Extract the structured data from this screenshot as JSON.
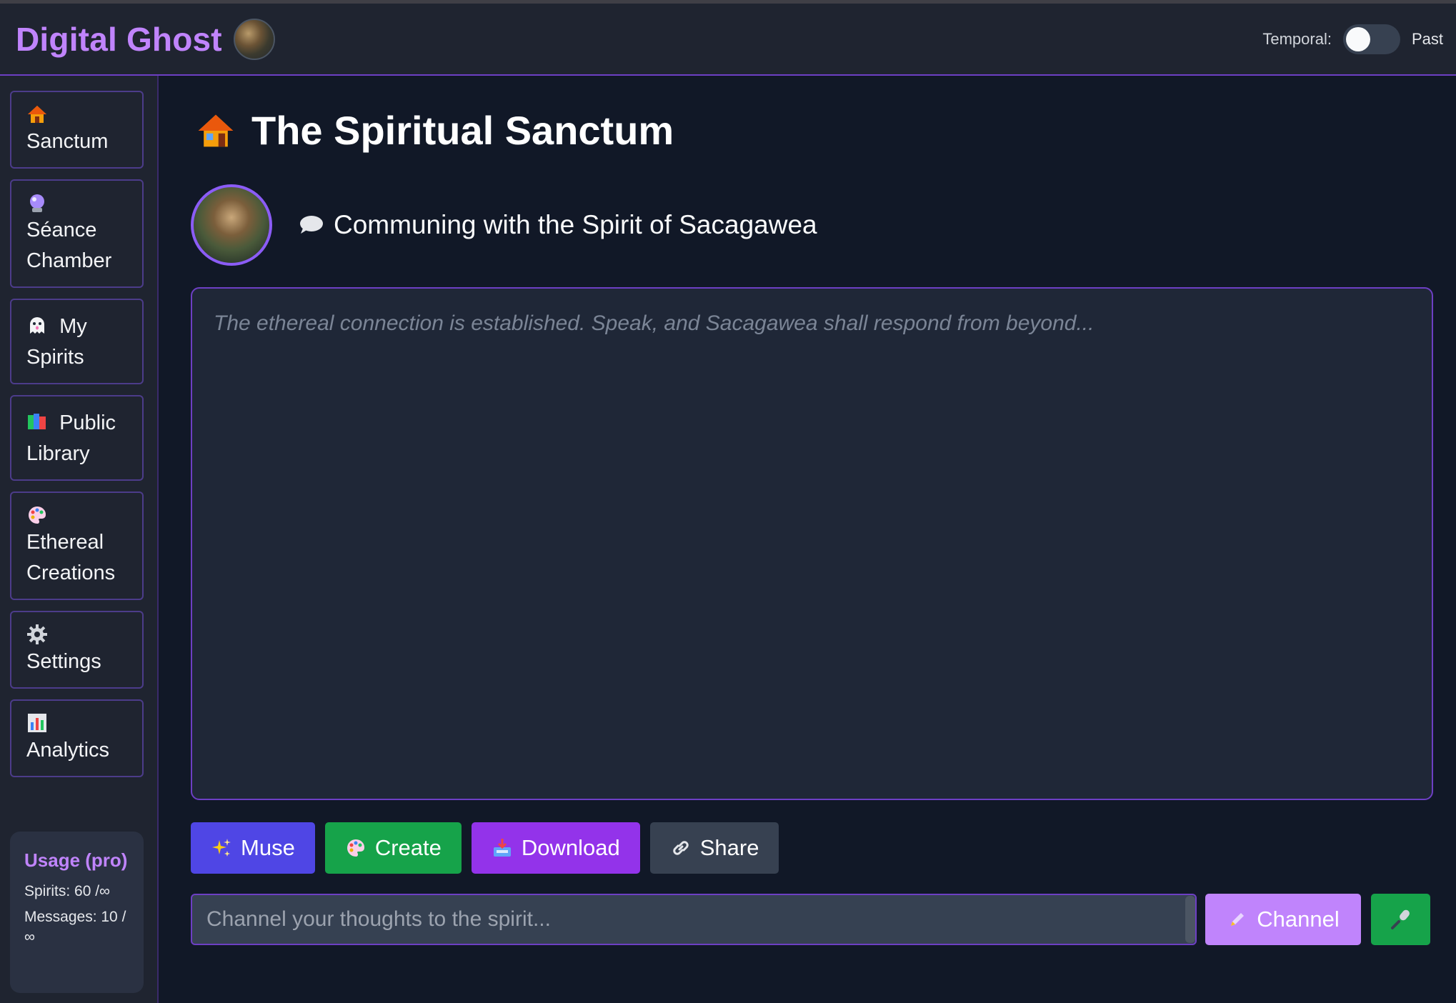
{
  "header": {
    "brand": "Digital Ghost",
    "temporal_label": "Temporal:",
    "temporal_value": "Past"
  },
  "sidebar": {
    "items": [
      {
        "label": "Sanctum",
        "icon": "house-icon"
      },
      {
        "label": "Séance Chamber",
        "icon": "crystal-ball-icon"
      },
      {
        "label": "My Spirits",
        "icon": "ghost-icon"
      },
      {
        "label": "Public Library",
        "icon": "books-icon"
      },
      {
        "label": "Ethereal Creations",
        "icon": "palette-icon"
      },
      {
        "label": "Settings",
        "icon": "gear-icon"
      },
      {
        "label": "Analytics",
        "icon": "bar-chart-icon"
      }
    ],
    "usage": {
      "title": "Usage (pro)",
      "spirits": "Spirits: 60 /∞",
      "messages": "Messages: 10 / ∞"
    }
  },
  "main": {
    "title": "The Spiritual Sanctum",
    "spirit_line": "Communing with the Spirit of Sacagawea",
    "chat_placeholder": "The ethereal connection is established. Speak, and Sacagawea shall respond from beyond...",
    "actions": {
      "muse": "Muse",
      "create": "Create",
      "download": "Download",
      "share": "Share"
    },
    "input": {
      "placeholder": "Channel your thoughts to the spirit...",
      "value": ""
    },
    "channel_label": "Channel"
  },
  "colors": {
    "accent": "#c084fc",
    "border": "#6d3fc4",
    "muse": "#4f46e5",
    "create": "#16a34a",
    "download": "#9333ea",
    "share": "#374151"
  }
}
